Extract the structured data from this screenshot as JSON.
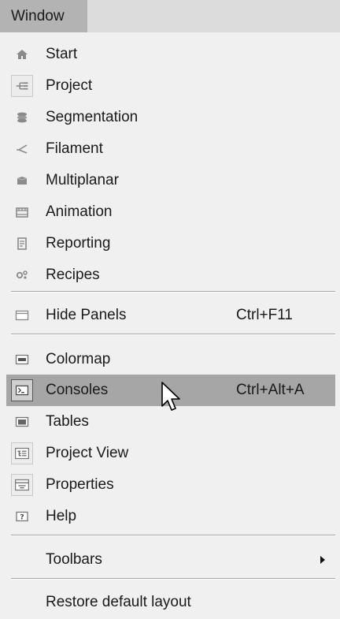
{
  "menubar": {
    "title": "Window"
  },
  "menu": {
    "items_group1": [
      {
        "label": "Start",
        "icon": "home-icon"
      },
      {
        "label": "Project",
        "icon": "project-tree-icon"
      },
      {
        "label": "Segmentation",
        "icon": "segmentation-icon"
      },
      {
        "label": "Filament",
        "icon": "filament-icon"
      },
      {
        "label": "Multiplanar",
        "icon": "multiplanar-icon"
      },
      {
        "label": "Animation",
        "icon": "animation-icon"
      },
      {
        "label": "Reporting",
        "icon": "reporting-icon"
      },
      {
        "label": "Recipes",
        "icon": "recipes-icon"
      }
    ],
    "hide_panels": {
      "label": "Hide Panels",
      "shortcut": "Ctrl+F11",
      "icon": "panel-icon"
    },
    "items_group3": [
      {
        "label": "Colormap",
        "icon": "colormap-icon"
      },
      {
        "label": "Consoles",
        "shortcut": "Ctrl+Alt+A",
        "icon": "console-icon",
        "highlighted": true
      },
      {
        "label": "Tables",
        "icon": "table-icon"
      },
      {
        "label": "Project View",
        "icon": "project-view-icon"
      },
      {
        "label": "Properties",
        "icon": "properties-icon"
      },
      {
        "label": "Help",
        "icon": "help-icon"
      }
    ],
    "toolbars": {
      "label": "Toolbars",
      "icon": "submenu-arrow-icon"
    },
    "restore": {
      "label": "Restore default layout"
    }
  },
  "colors": {
    "highlight": "#a6a6a6",
    "menubar_active": "#b3b3b3",
    "menu_bg": "#f0f0f0"
  }
}
